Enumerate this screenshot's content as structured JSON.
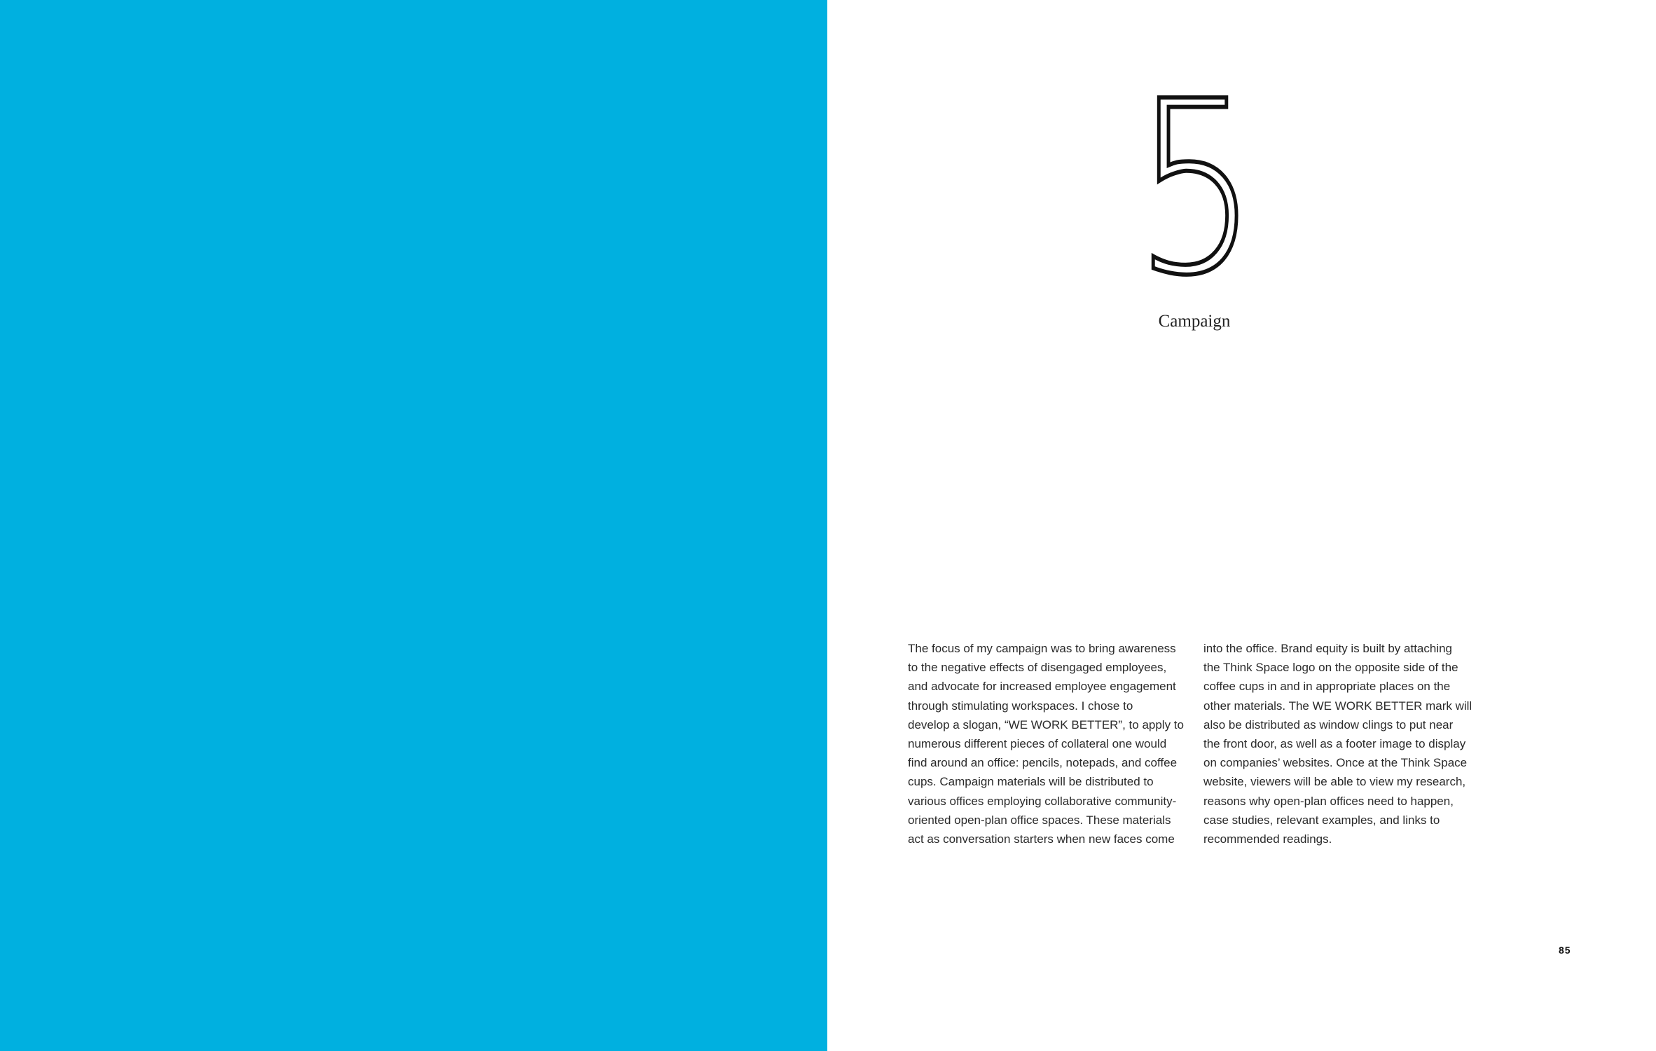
{
  "colors": {
    "left_panel": "#00b0e0",
    "text": "#2a2a2a",
    "numeral": "#111111"
  },
  "chapter": {
    "number": "5",
    "title": "Campaign"
  },
  "body": {
    "column_1": [
      "The focus of my campaign was to bring awareness",
      "to the negative effects of disengaged employees,",
      "and advocate for increased employee engagement",
      "through stimulating workspaces. I chose to",
      "develop a slogan, “WE WORK BETTER”, to apply to",
      "numerous different pieces of collateral one would",
      "find around an office: pencils, notepads, and coffee",
      "cups. Campaign materials will be distributed to",
      "various offices employing collaborative community-",
      "oriented open-plan office spaces. These materials",
      "act as conversation starters when new faces come"
    ],
    "column_2": [
      "into the office. Brand equity is built by attaching",
      "the Think Space logo on the opposite side of the",
      "coffee cups in and in appropriate places on the",
      "other materials. The WE WORK BETTER mark will",
      "also be distributed as window clings to put near",
      "the front door, as well as a footer image to display",
      "on companies’ websites. Once at the Think Space",
      "website, viewers will be able to view my research,",
      "reasons why open-plan offices need to happen,",
      "case studies, relevant examples, and links to",
      "recommended readings."
    ]
  },
  "page_number": "85"
}
